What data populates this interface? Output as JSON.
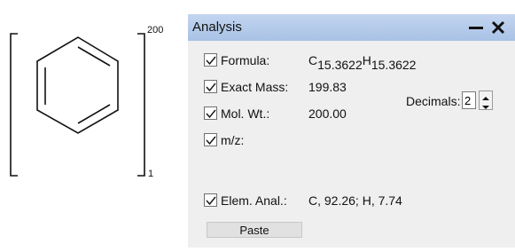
{
  "structure": {
    "repeat_count_label": "200",
    "bottom_label": "1"
  },
  "panel": {
    "title": "Analysis",
    "minimize_icon": "minimize-icon",
    "close_icon": "close-icon",
    "formula": {
      "label": "Formula:",
      "checked": true,
      "c": "C",
      "c_sub": "15.3622",
      "h": "H",
      "h_sub": "15.3622"
    },
    "exact_mass": {
      "label": "Exact Mass:",
      "checked": true,
      "value": "199.83"
    },
    "mol_wt": {
      "label": "Mol. Wt.:",
      "checked": true,
      "value": "200.00"
    },
    "mz": {
      "label": "m/z:",
      "checked": true,
      "value": ""
    },
    "decimals": {
      "label": "Decimals:",
      "value": "2"
    },
    "elem_anal": {
      "label": "Elem. Anal.:",
      "checked": true,
      "value": "C, 92.26; H, 7.74"
    },
    "paste_label": "Paste"
  },
  "colors": {
    "titlebar": "#b6cbeb",
    "panel_bg": "#efefef",
    "check": "#1a1a1a"
  }
}
